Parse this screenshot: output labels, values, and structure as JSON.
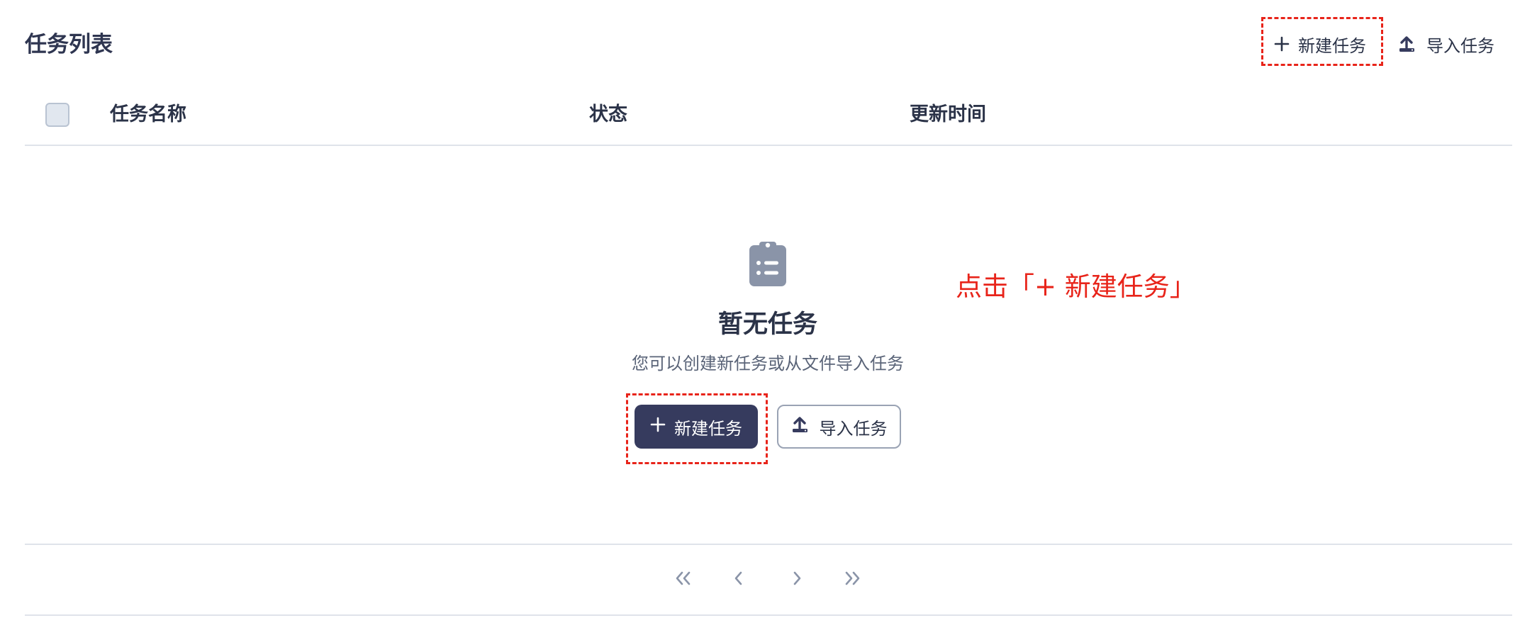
{
  "header": {
    "title": "任务列表",
    "new_task_label": "新建任务",
    "import_task_label": "导入任务"
  },
  "table": {
    "columns": [
      "任务名称",
      "状态",
      "更新时间"
    ],
    "rows": []
  },
  "empty_state": {
    "icon": "clipboard-list-icon",
    "title": "暂无任务",
    "description": "您可以创建新任务或从文件导入任务",
    "new_task_label": "新建任务",
    "import_task_label": "导入任务"
  },
  "annotation": {
    "text": "点击「+ 新建任务」",
    "color": "#e8241a"
  },
  "pagination": {
    "icons": [
      "double-chevron-left-icon",
      "chevron-left-icon",
      "chevron-right-icon",
      "double-chevron-right-icon"
    ]
  },
  "colors": {
    "primary": "#363b5e",
    "text": "#2b3348",
    "muted": "#5a6478",
    "border": "#dfe3ea"
  }
}
